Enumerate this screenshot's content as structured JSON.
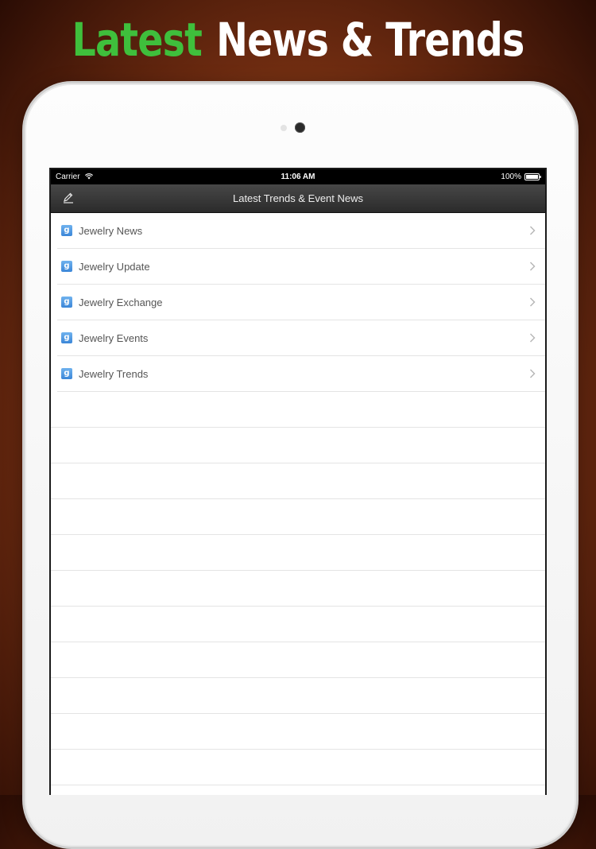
{
  "promo": {
    "title_accent": "Latest",
    "title_rest": "News & Trends",
    "accent_color": "#3fbf3c"
  },
  "status_bar": {
    "carrier": "Carrier",
    "time": "11:06 AM",
    "battery": "100%"
  },
  "nav": {
    "title": "Latest Trends & Event News",
    "left_icon": "pencil-icon"
  },
  "list": {
    "item_icon": "google-news-icon",
    "items": [
      {
        "label": "Jewelry News"
      },
      {
        "label": "Jewelry Update"
      },
      {
        "label": "Jewelry Exchange"
      },
      {
        "label": "Jewelry Events"
      },
      {
        "label": "Jewelry Trends"
      }
    ]
  }
}
